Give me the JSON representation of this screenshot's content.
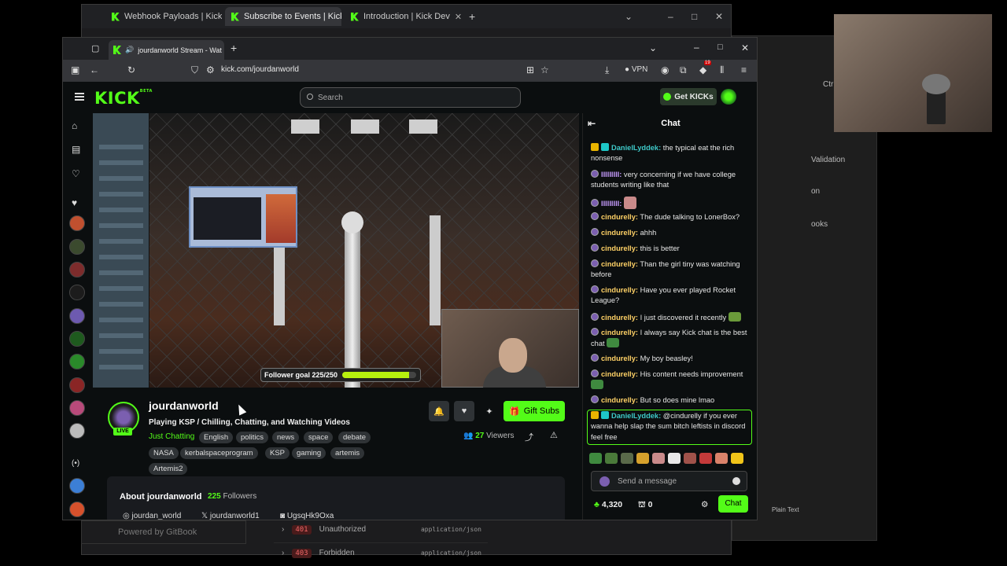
{
  "bg_browser": {
    "tabs": [
      {
        "label": "Webhook Payloads | Kick Dev"
      },
      {
        "label": "Subscribe to Events | Kick Dev"
      },
      {
        "label": "Introduction | Kick Dev"
      }
    ],
    "gitbook": "Powered by GitBook",
    "responses": [
      {
        "code": "401",
        "label": "Unauthorized",
        "type": "application/json"
      },
      {
        "code": "403",
        "label": "Forbidden",
        "type": "application/json"
      }
    ]
  },
  "bg_right": {
    "texts": [
      "Validation",
      "on",
      "ooks"
    ],
    "ctrl": "Ctrl",
    "plain_text": "Plain Text"
  },
  "browser": {
    "tab_title": "jourdanworld Stream - Wat",
    "url": "kick.com/jourdanworld",
    "vpn_label": "VPN",
    "ext_badge": "19"
  },
  "header": {
    "logo": "KICK",
    "logo_badge": "BETA",
    "search_placeholder": "Search",
    "get_kicks": "Get KICKs"
  },
  "video": {
    "follower_goal": "Follower goal 225/250",
    "goal_progress": 0.9
  },
  "stream": {
    "streamer": "jourdanworld",
    "live": "LIVE",
    "title": "Playing KSP / Chilling, Chatting, and Watching Videos",
    "category": "Just Chatting",
    "tags": [
      "English",
      "politics",
      "news",
      "space",
      "debate",
      "NASA",
      "kerbalspaceprogram",
      "KSP",
      "gaming",
      "artemis",
      "Artemis2"
    ],
    "gift_subs": "Gift Subs",
    "viewers_count": "27",
    "viewers_label": "Viewers"
  },
  "about": {
    "title": "About jourdanworld",
    "followers_count": "225",
    "followers_label": "Followers",
    "instagram": "jourdan_world",
    "x": "jourdanworld1",
    "discord": "UgsqHk9Oxa"
  },
  "chat": {
    "title": "Chat",
    "messages": [
      {
        "user": "DanielLyddek:",
        "text": " the typical eat the rich nonsense"
      },
      {
        "user": "IIIIIIIII:",
        "text": " very concerning if we have college students writing like that"
      },
      {
        "user": "IIIIIIIII:",
        "text": ""
      },
      {
        "user": "cindurelly:",
        "text": " The dude talking to LonerBox?"
      },
      {
        "user": "cindurelly:",
        "text": " ahhh"
      },
      {
        "user": "cindurelly:",
        "text": " this is better"
      },
      {
        "user": "cindurelly:",
        "text": " Than the girl tiny was watching before"
      },
      {
        "user": "cindurelly:",
        "text": " Have you ever played Rocket League?"
      },
      {
        "user": "cindurelly:",
        "text": " I just discovered it recently"
      },
      {
        "user": "cindurelly:",
        "text": " I always say Kick chat is the best chat"
      },
      {
        "user": "cindurelly:",
        "text": " My boy beasley!"
      },
      {
        "user": "cindurelly:",
        "text": " His content needs improvement"
      },
      {
        "user": "cindurelly:",
        "text": " But so does mine lmao"
      },
      {
        "user": "DanielLyddek:",
        "text": " @cindurelly if you ever wanna help slap the sum bitch leftists in discord feel free"
      }
    ],
    "input_placeholder": "Send a message",
    "kicks_count": "4,320",
    "store_count": "0",
    "chat_button": "Chat",
    "colors": {
      "daniel": "#3ec9c9",
      "iii": "#c79cff",
      "cindurelly": "#ffd166",
      "accent": "#53fc18"
    }
  }
}
